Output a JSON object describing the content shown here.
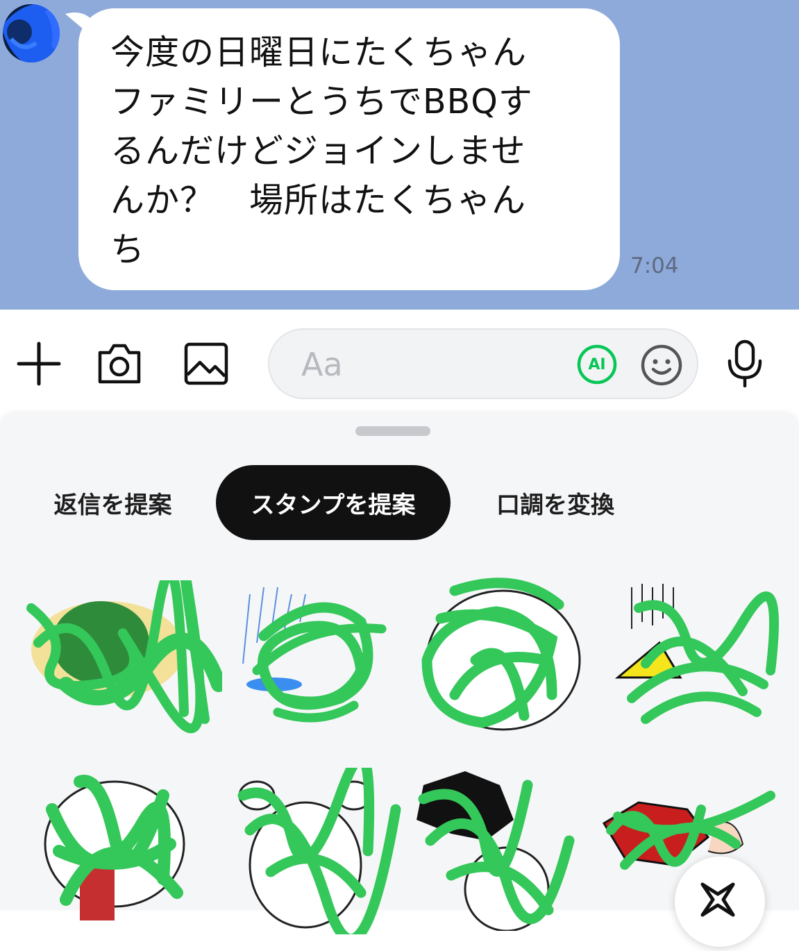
{
  "message": {
    "text": "今度の日曜日にたくちゃん\nファミリーとうちでBBQす\nるんだけどジョインしませ\nんか？　場所はたくちゃん\nち",
    "time": "7:04"
  },
  "input": {
    "placeholder": "Aa",
    "ai_badge": "AI"
  },
  "icons": {
    "plus": "plus-icon",
    "camera": "camera-icon",
    "image": "image-icon",
    "ai": "ai-icon",
    "emoji": "emoji-icon",
    "mic": "microphone-icon",
    "sparkle": "sparkle-icon"
  },
  "colors": {
    "chat_background": "#8daadb",
    "ai_green": "#06c755",
    "scribble_green": "#34c759",
    "active_tab": "#111111"
  },
  "tabs": [
    {
      "label": "返信を提案",
      "active": false
    },
    {
      "label": "スタンプを提案",
      "active": true
    },
    {
      "label": "口調を変換",
      "active": false
    }
  ]
}
